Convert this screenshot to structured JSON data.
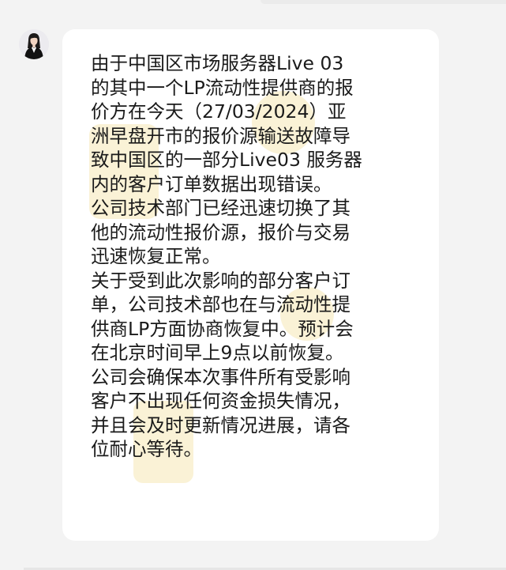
{
  "chat": {
    "sender_avatar": "avatar-woman-in-black-suit",
    "message_lines": [
      "由于中国区市场服务器Live 03",
      "的其中一个LP流动性提供商的报",
      "价方在今天（27/03/2024）亚",
      "洲早盘开市的报价源输送故障导",
      "致中国区的一部分Live03 服务器",
      "内的客户订单数据出现错误。",
      "公司技术部门已经迅速切换了其",
      "他的流动性报价源，报价与交易",
      "迅速恢复正常。",
      "关于受到此次影响的部分客户订",
      "单，公司技术部也在与流动性提",
      "供商LP方面协商恢复中。预计会",
      "在北京时间早上9点以前恢复。",
      "公司会确保本次事件所有受影响",
      "客户不出现任何资金损失情况，",
      "并且会及时更新情况进展，请各",
      "位耐心等待。"
    ]
  },
  "colors": {
    "background": "#f3f3f3",
    "bubble": "#ffffff",
    "text": "#1a1a1a",
    "watermark": "#f2d98a"
  }
}
